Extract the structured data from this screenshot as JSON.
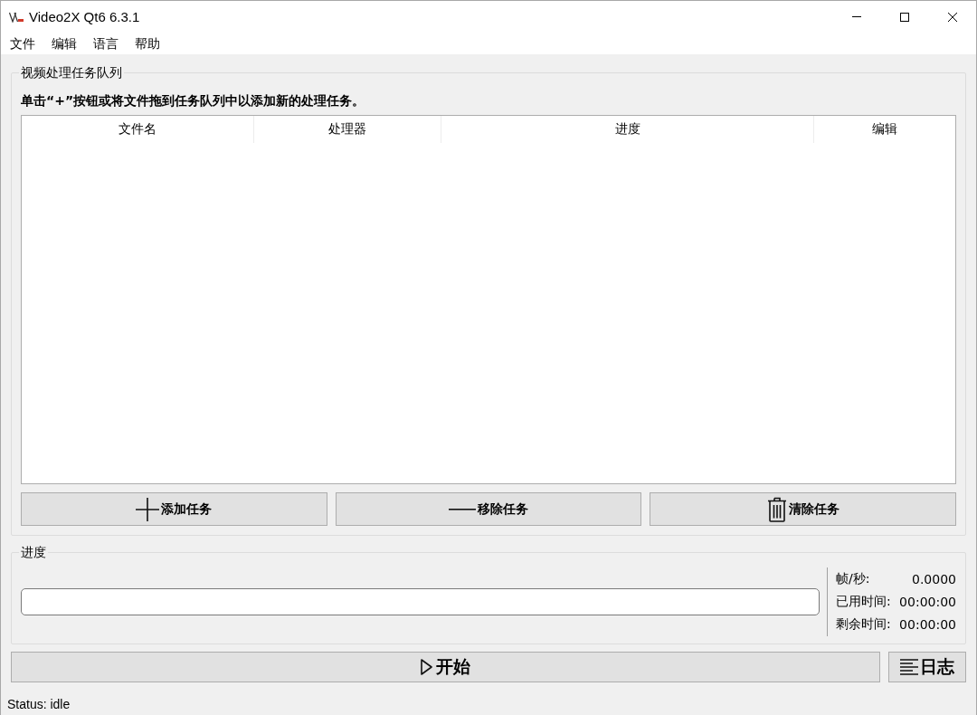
{
  "window": {
    "title": "Video2X Qt6 6.3.1"
  },
  "menu": [
    "文件",
    "编辑",
    "语言",
    "帮助"
  ],
  "task_queue": {
    "title": "视频处理任务队列",
    "hint": "单击“+”按钮或将文件拖到任务队列中以添加新的处理任务。",
    "table": {
      "columns": [
        "文件名",
        "处理器",
        "进度",
        "编辑"
      ]
    },
    "buttons": [
      {
        "kind": "add",
        "label": "添加任务"
      },
      {
        "kind": "remove",
        "label": "移除任务"
      },
      {
        "kind": "clear",
        "label": "清除任务"
      }
    ]
  },
  "progress": {
    "title": "进度",
    "level": 0,
    "stats": [
      {
        "label": "帧/秒:",
        "value": "0.0000"
      },
      {
        "label": "已用时间:",
        "value": "00:00:00"
      },
      {
        "label": "剩余时间:",
        "value": "00:00:00"
      }
    ]
  },
  "actions": [
    {
      "kind": "start",
      "label": "开始"
    },
    {
      "kind": "log",
      "label": "日志"
    }
  ],
  "status_bar": "Status: idle"
}
